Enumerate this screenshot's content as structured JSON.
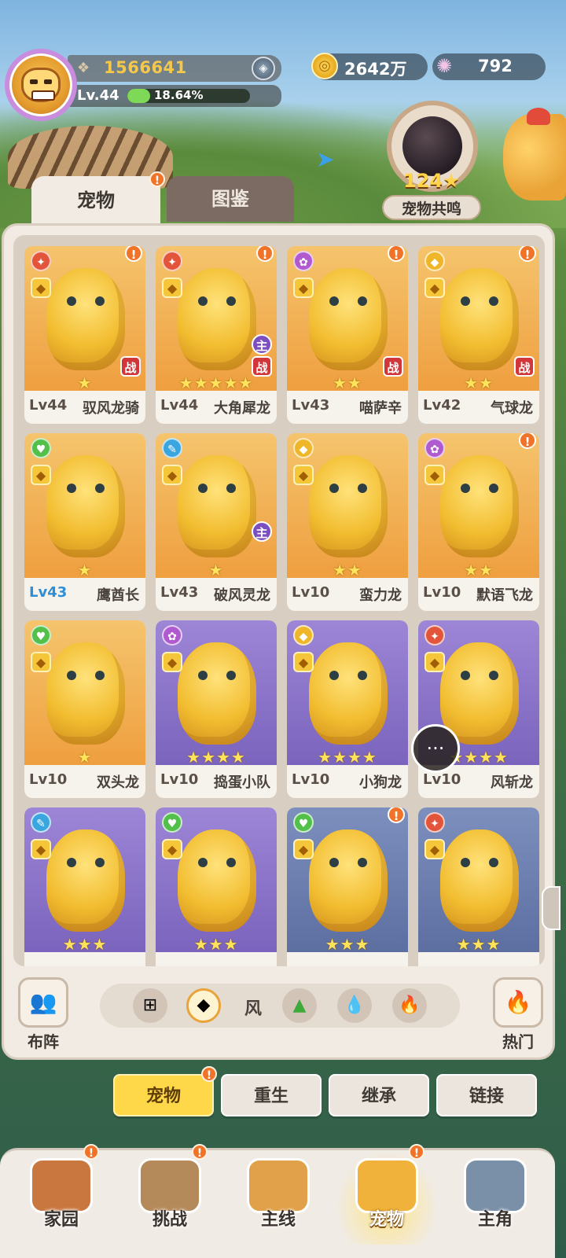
{
  "player": {
    "score": "1566641",
    "level": "Lv.44",
    "xp_percent": 18.64,
    "xp_text": "18.64%"
  },
  "currency": {
    "gold": "2642万",
    "shells": "792"
  },
  "resonance": {
    "count": "124",
    "label": "宠物共鸣"
  },
  "tabs": [
    {
      "label": "宠物",
      "active": true
    },
    {
      "label": "图鉴",
      "active": false
    }
  ],
  "pets": [
    {
      "level": "Lv44",
      "name": "驭风龙骑",
      "stars": "★",
      "bg": "gold",
      "element": "fire",
      "tag": "战",
      "alert": true
    },
    {
      "level": "Lv44",
      "name": "大角犀龙",
      "stars": "★★★★★",
      "bg": "gold",
      "element": "fire",
      "tag": "战",
      "main": "主",
      "alert": true
    },
    {
      "level": "Lv43",
      "name": "喵萨辛",
      "stars": "★★",
      "bg": "gold",
      "element": "purple",
      "tag": "战",
      "alert": true
    },
    {
      "level": "Lv42",
      "name": "气球龙",
      "stars": "★★",
      "bg": "gold",
      "element": "gold",
      "tag": "战",
      "alert": true
    },
    {
      "level": "Lv43",
      "name": "鹰酋长",
      "stars": "★",
      "bg": "gold",
      "element": "green",
      "level_highlight": true
    },
    {
      "level": "Lv43",
      "name": "破风灵龙",
      "stars": "★",
      "bg": "gold",
      "element": "blue",
      "main": "主"
    },
    {
      "level": "Lv10",
      "name": "蛮力龙",
      "stars": "★★",
      "bg": "gold",
      "element": "gold"
    },
    {
      "level": "Lv10",
      "name": "默语飞龙",
      "stars": "★★",
      "bg": "gold",
      "element": "purple",
      "alert": true
    },
    {
      "level": "Lv10",
      "name": "双头龙",
      "stars": "★",
      "bg": "gold",
      "element": "green"
    },
    {
      "level": "Lv10",
      "name": "捣蛋小队",
      "stars": "★★★★",
      "bg": "purple",
      "element": "purple"
    },
    {
      "level": "Lv10",
      "name": "小狗龙",
      "stars": "★★★★",
      "bg": "purple",
      "element": "gold"
    },
    {
      "level": "Lv10",
      "name": "风斩龙",
      "stars": "★★★★",
      "bg": "purple",
      "element": "fire"
    },
    {
      "level": "",
      "name": "",
      "stars": "★★★",
      "bg": "purple",
      "element": "blue"
    },
    {
      "level": "",
      "name": "",
      "stars": "★★★",
      "bg": "purple",
      "element": "green"
    },
    {
      "level": "",
      "name": "",
      "stars": "★★★",
      "bg": "blue",
      "element": "green",
      "alert": true
    },
    {
      "level": "",
      "name": "",
      "stars": "★★★",
      "bg": "blue",
      "element": "fire"
    }
  ],
  "filters": {
    "formation_label": "布阵",
    "element_label": "风",
    "hot_label": "热门"
  },
  "subtabs": [
    {
      "label": "宠物",
      "active": true
    },
    {
      "label": "重生",
      "active": false
    },
    {
      "label": "继承",
      "active": false
    },
    {
      "label": "链接",
      "active": false
    }
  ],
  "nav": [
    {
      "label": "家园"
    },
    {
      "label": "挑战"
    },
    {
      "label": "主线"
    },
    {
      "label": "宠物",
      "active": true
    },
    {
      "label": "主角"
    }
  ],
  "colors": {
    "accent": "#f07328",
    "gold": "#ffd84a",
    "xp_bar": "#7ed957"
  }
}
